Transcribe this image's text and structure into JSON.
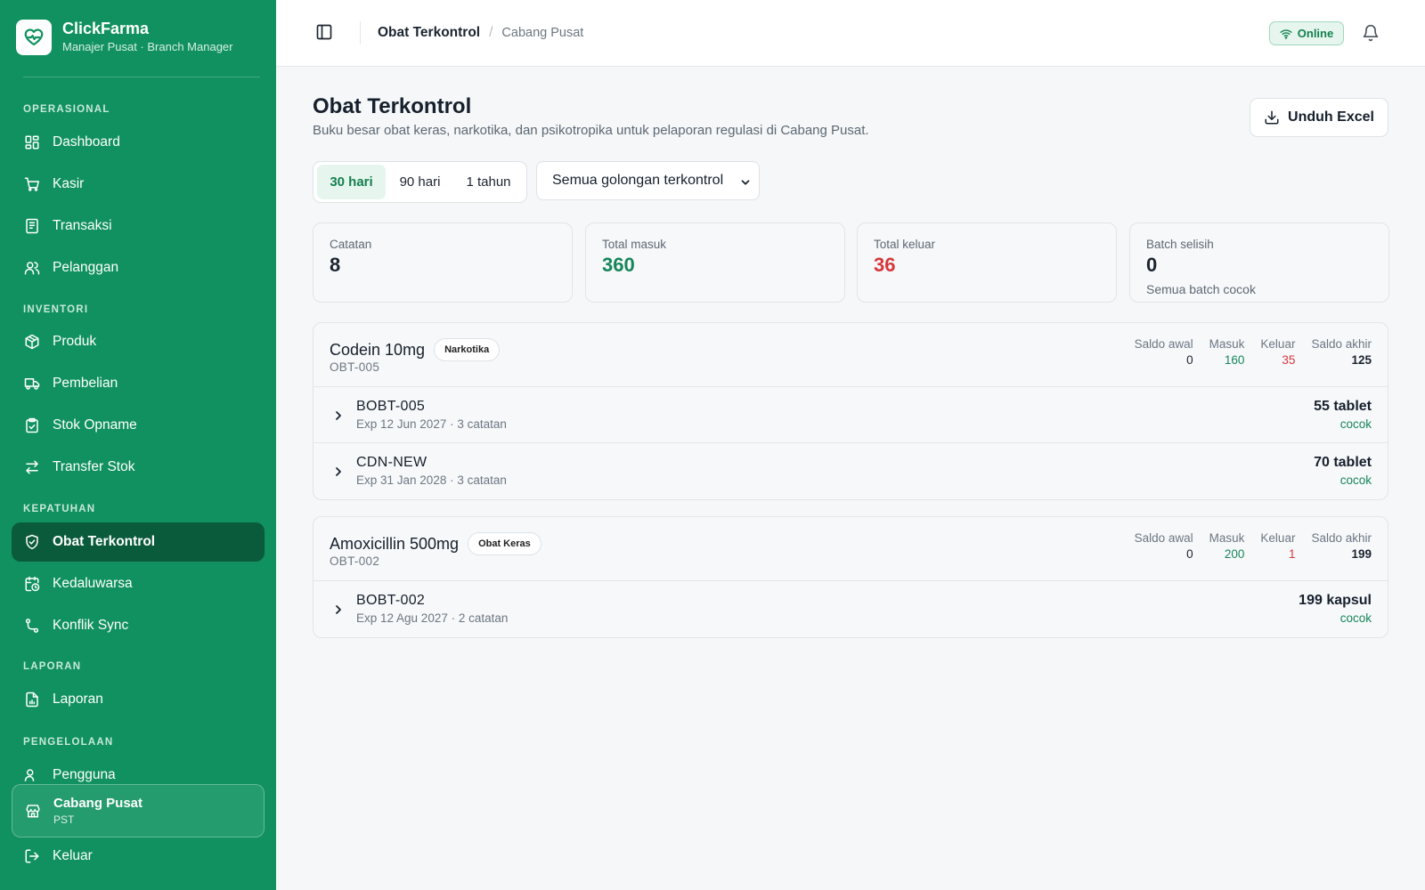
{
  "app": {
    "name": "ClickFarma",
    "subtitle": "Manajer Pusat · Branch Manager"
  },
  "sidebar": {
    "sections": [
      {
        "label": "OPERASIONAL",
        "items": [
          {
            "label": "Dashboard",
            "icon": "dashboard-icon"
          },
          {
            "label": "Kasir",
            "icon": "cart-icon"
          },
          {
            "label": "Transaksi",
            "icon": "receipt-icon"
          },
          {
            "label": "Pelanggan",
            "icon": "users-icon"
          }
        ]
      },
      {
        "label": "INVENTORI",
        "items": [
          {
            "label": "Produk",
            "icon": "box-icon"
          },
          {
            "label": "Pembelian",
            "icon": "truck-icon"
          },
          {
            "label": "Stok Opname",
            "icon": "clipboard-check-icon"
          },
          {
            "label": "Transfer Stok",
            "icon": "transfer-icon"
          }
        ]
      },
      {
        "label": "KEPATUHAN",
        "items": [
          {
            "label": "Obat Terkontrol",
            "icon": "shield-icon",
            "active": true
          },
          {
            "label": "Kedaluwarsa",
            "icon": "calendar-clock-icon"
          },
          {
            "label": "Konflik Sync",
            "icon": "git-branch-icon"
          }
        ]
      },
      {
        "label": "LAPORAN",
        "items": [
          {
            "label": "Laporan",
            "icon": "report-icon"
          }
        ]
      },
      {
        "label": "PENGELOLAAN",
        "items": [
          {
            "label": "Pengguna",
            "icon": "user-icon"
          }
        ]
      }
    ],
    "branch": {
      "name": "Cabang Pusat",
      "code": "PST"
    },
    "logout": "Keluar"
  },
  "topbar": {
    "title": "Obat Terkontrol",
    "separator": "/",
    "branch": "Cabang Pusat",
    "status": "Online"
  },
  "page": {
    "title": "Obat Terkontrol",
    "description": "Buku besar obat keras, narkotika, dan psikotropika untuk pelaporan regulasi di Cabang Pusat.",
    "export_label": "Unduh Excel",
    "ranges": [
      {
        "label": "30 hari",
        "active": true
      },
      {
        "label": "90 hari",
        "active": false
      },
      {
        "label": "1 tahun",
        "active": false
      }
    ],
    "filter": "Semua golongan terkontrol"
  },
  "stats": [
    {
      "label": "Catatan",
      "value": "8"
    },
    {
      "label": "Total masuk",
      "value": "360"
    },
    {
      "label": "Total keluar",
      "value": "36"
    },
    {
      "label": "Batch selisih",
      "value": "0",
      "note": "Semua batch cocok"
    }
  ],
  "groups": [
    {
      "name": "Codein 10mg",
      "badge": "Narkotika",
      "code": "OBT-005",
      "stats": {
        "saldo_awal_label": "Saldo awal",
        "saldo_awal": "0",
        "masuk_label": "Masuk",
        "masuk": "160",
        "keluar_label": "Keluar",
        "keluar": "35",
        "saldo_akhir_label": "Saldo akhir",
        "saldo_akhir": "125"
      },
      "batches": [
        {
          "code": "BOBT-005",
          "meta": "Exp 12 Jun 2027 · 3 catatan",
          "qty": "55 tablet",
          "status": "cocok"
        },
        {
          "code": "CDN-NEW",
          "meta": "Exp 31 Jan 2028 · 3 catatan",
          "qty": "70 tablet",
          "status": "cocok"
        }
      ]
    },
    {
      "name": "Amoxicillin 500mg",
      "badge": "Obat Keras",
      "code": "OBT-002",
      "stats": {
        "saldo_awal_label": "Saldo awal",
        "saldo_awal": "0",
        "masuk_label": "Masuk",
        "masuk": "200",
        "keluar_label": "Keluar",
        "keluar": "1",
        "saldo_akhir_label": "Saldo akhir",
        "saldo_akhir": "199"
      },
      "batches": [
        {
          "code": "BOBT-002",
          "meta": "Exp 12 Agu 2027 · 2 catatan",
          "qty": "199 kapsul",
          "status": "cocok"
        }
      ]
    }
  ],
  "colors": {
    "sidebar": "#10915f",
    "sidebar_active": "#0a5b3c",
    "accent_green": "#16865a",
    "accent_red": "#d6373b"
  }
}
